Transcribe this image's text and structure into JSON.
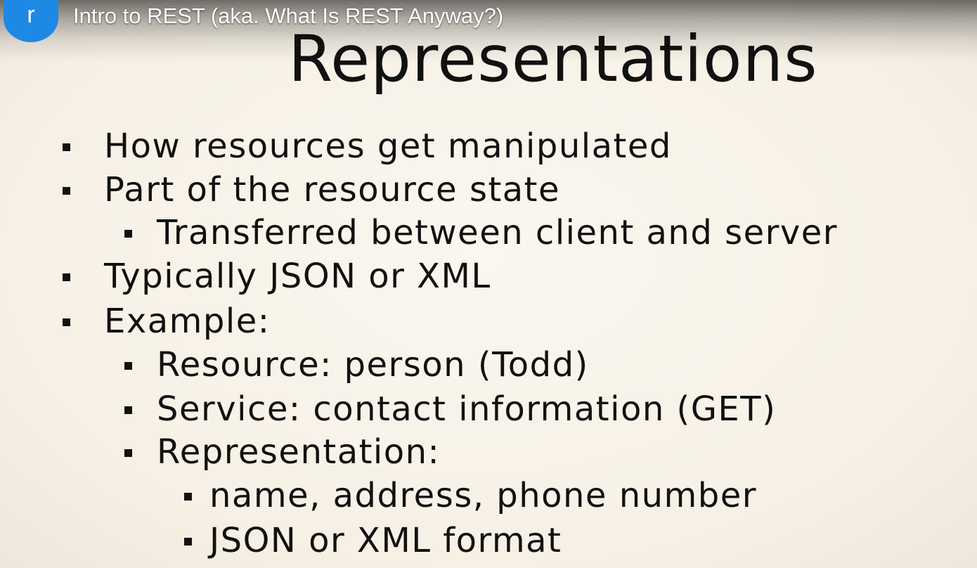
{
  "player": {
    "channel_initial": "r",
    "video_title": "Intro to REST (aka. What Is REST Anyway?)"
  },
  "slide": {
    "title": "Representations",
    "bullets": [
      {
        "level": 1,
        "text": "How resources get manipulated"
      },
      {
        "level": 1,
        "text": "Part of the resource state"
      },
      {
        "level": 2,
        "text": "Transferred between client and server"
      },
      {
        "level": 1,
        "text": "Typically JSON or XML"
      },
      {
        "level": 1,
        "text": "Example:"
      },
      {
        "level": 2,
        "text": "Resource: person (Todd)"
      },
      {
        "level": 2,
        "text": "Service: contact information (GET)"
      },
      {
        "level": 2,
        "text": "Representation:"
      },
      {
        "level": 3,
        "text": "name, address, phone number"
      },
      {
        "level": 3,
        "text": "JSON or XML format"
      }
    ]
  },
  "colors": {
    "avatar": "#1e88e5",
    "slide_background": "#f7f2e8",
    "text": "#111111"
  }
}
